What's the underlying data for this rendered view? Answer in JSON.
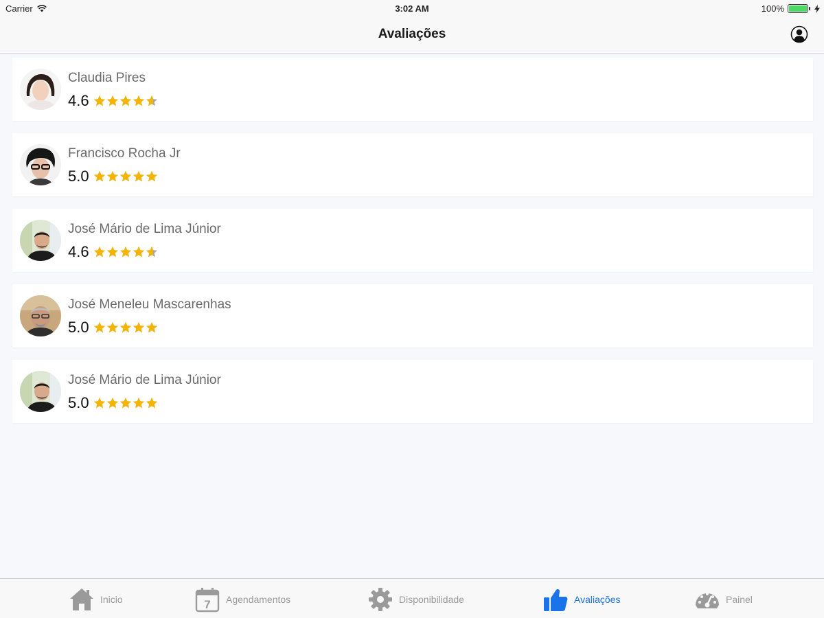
{
  "status_bar": {
    "carrier": "Carrier",
    "time": "3:02 AM",
    "battery_text": "100%",
    "battery_level": 1.0,
    "battery_color": "#4cd964"
  },
  "nav": {
    "title": "Avaliações",
    "profile_icon": "profile-icon"
  },
  "reviews": [
    {
      "name": "Claudia Pires",
      "rating": "4.6",
      "rating_value": 4.6
    },
    {
      "name": "Francisco Rocha Jr",
      "rating": "5.0",
      "rating_value": 5.0
    },
    {
      "name": "José Mário de Lima Júnior",
      "rating": "4.6",
      "rating_value": 4.6
    },
    {
      "name": "José Meneleu Mascarenhas",
      "rating": "5.0",
      "rating_value": 5.0
    },
    {
      "name": "José Mário de Lima Júnior",
      "rating": "5.0",
      "rating_value": 5.0
    }
  ],
  "tabs": [
    {
      "label": "Inicio",
      "icon": "home-icon",
      "active": false
    },
    {
      "label": "Agendamentos",
      "icon": "calendar-icon",
      "active": false,
      "icon_text": "7"
    },
    {
      "label": "Disponibilidade",
      "icon": "gear-icon",
      "active": false
    },
    {
      "label": "Avaliações",
      "icon": "thumbs-up-icon",
      "active": true
    },
    {
      "label": "Painel",
      "icon": "dashboard-icon",
      "active": false
    }
  ],
  "colors": {
    "star": "#f5b400",
    "star_empty": "#a8a8a8",
    "tab_active": "#1a73e8",
    "tab_inactive": "#9a9a9a"
  }
}
